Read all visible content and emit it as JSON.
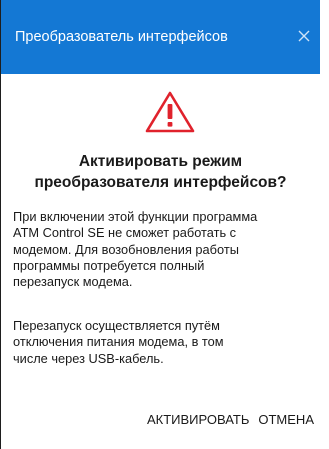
{
  "dialog": {
    "title": "Преобразователь интерфейсов",
    "close_icon": "close-icon",
    "warning_icon": "warning-triangle-icon",
    "heading_lines": [
      "Активировать режим",
      "преобразователя интерфейсов?"
    ],
    "paragraph1_lines": [
      "При включении этой функции программа",
      "ATM Control SE не сможет работать с",
      "модемом. Для возобновления работы",
      "программы потребуется полный",
      "перезапуск модема."
    ],
    "paragraph2_lines": [
      "Перезапуск осуществляется путём",
      "отключения питания модема, в том",
      "числе через USB-кабель."
    ],
    "buttons": {
      "activate_label": "АКТИВИРОВАТЬ",
      "cancel_label": "ОТМЕНА"
    }
  },
  "colors": {
    "titlebar": "#1478d4",
    "warning": "#e0222c"
  }
}
